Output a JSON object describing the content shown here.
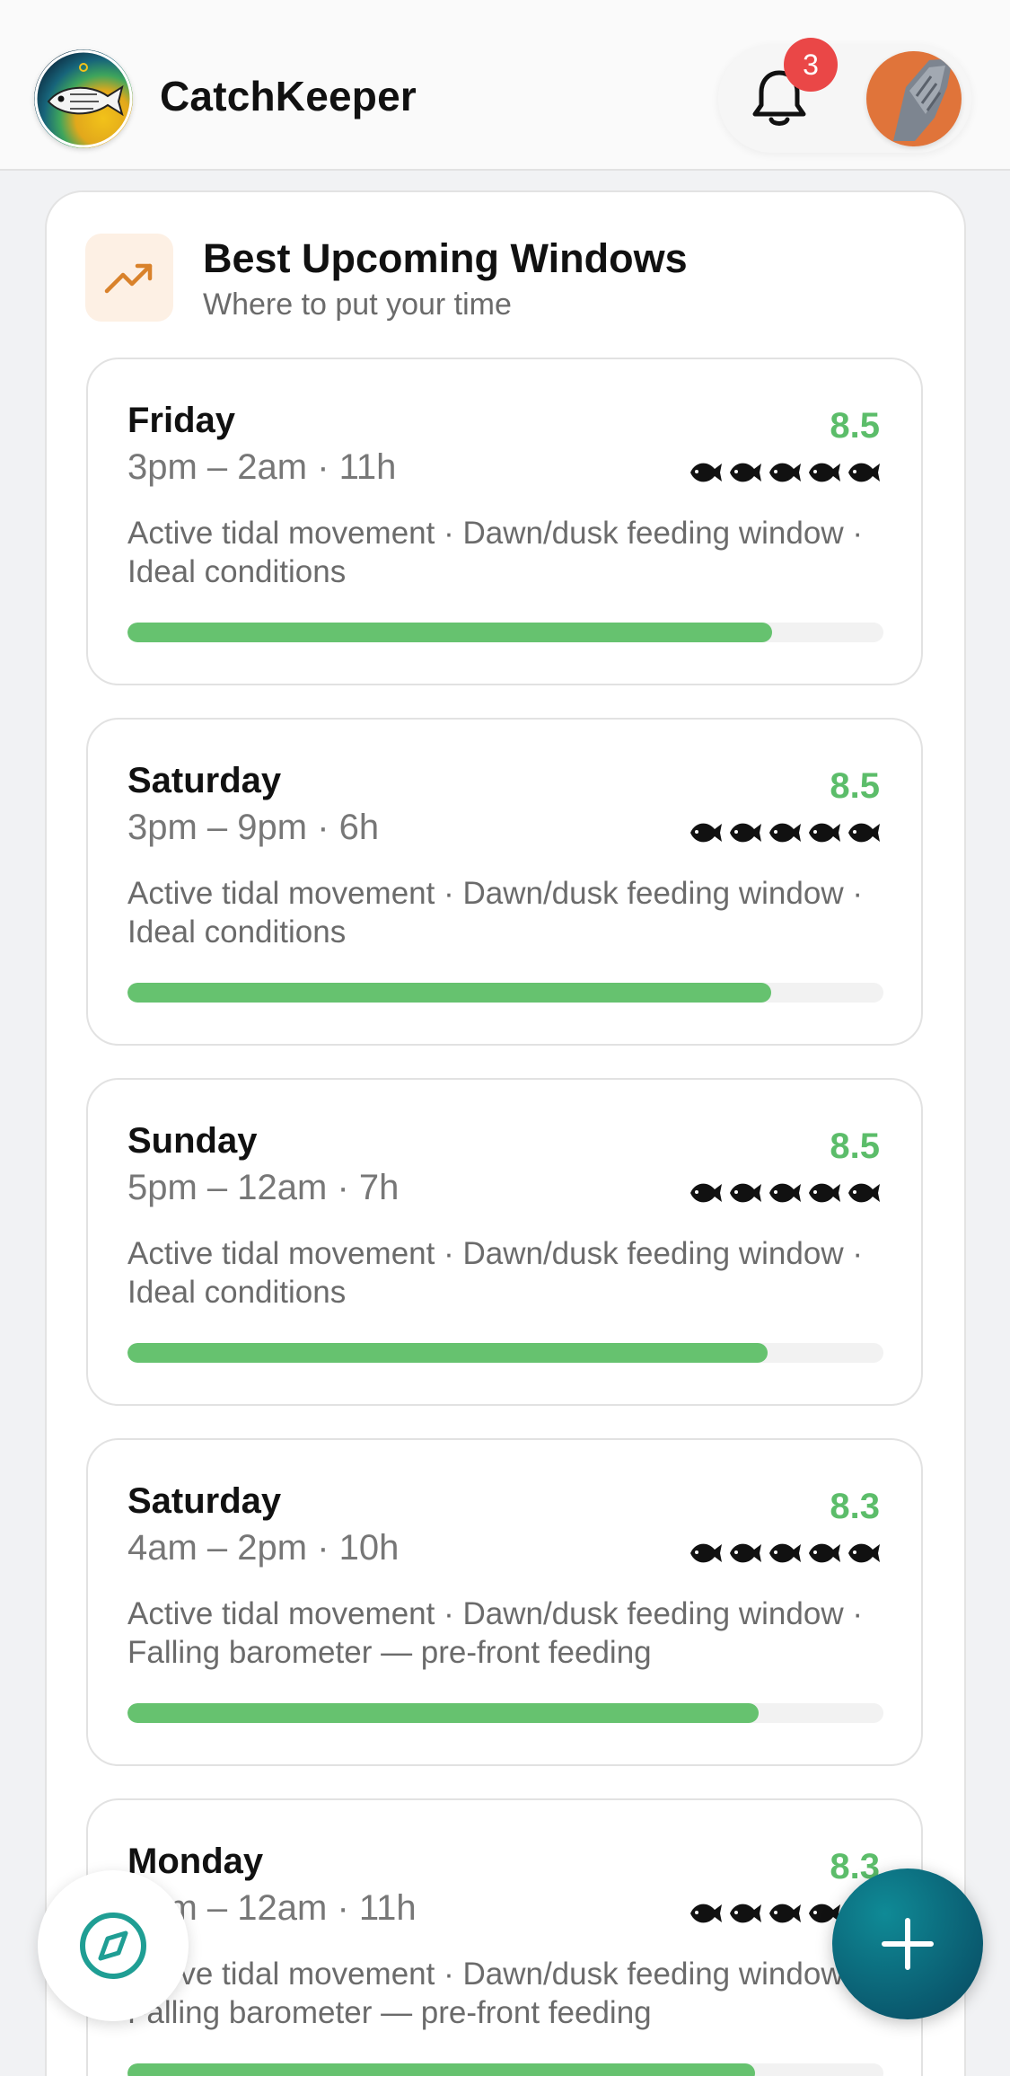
{
  "app": {
    "title": "CatchKeeper",
    "notification_count": "3"
  },
  "section": {
    "title": "Best Upcoming Windows",
    "subtitle": "Where to put your time",
    "icon": "trending-up-icon"
  },
  "colors": {
    "score_green": "#5cbd6a",
    "bar_fill": "#66c26f",
    "accent_orange": "#d9822b",
    "fab_teal": "#0a5a6f",
    "badge_red": "#ea4747"
  },
  "windows": [
    {
      "day": "Friday",
      "time": "3pm – 2am · 11h",
      "score": "8.5",
      "fish_rating": 5,
      "reasons": "Active tidal movement · Dawn/dusk feeding window · Ideal conditions",
      "progress": 0.853
    },
    {
      "day": "Saturday",
      "time": "3pm – 9pm · 6h",
      "score": "8.5",
      "fish_rating": 5,
      "reasons": "Active tidal movement · Dawn/dusk feeding window · Ideal conditions",
      "progress": 0.851
    },
    {
      "day": "Sunday",
      "time": "5pm – 12am · 7h",
      "score": "8.5",
      "fish_rating": 5,
      "reasons": "Active tidal movement · Dawn/dusk feeding window · Ideal conditions",
      "progress": 0.847
    },
    {
      "day": "Saturday",
      "time": "4am – 2pm · 10h",
      "score": "8.3",
      "fish_rating": 5,
      "reasons": "Active tidal movement · Dawn/dusk feeding window · Falling barometer — pre-front feeding",
      "progress": 0.835
    },
    {
      "day": "Monday",
      "time": "1pm – 12am · 11h",
      "score": "8.3",
      "fish_rating": 5,
      "reasons": "Active tidal movement · Dawn/dusk feeding window · Falling barometer — pre-front feeding",
      "progress": 0.83
    }
  ],
  "fab": {
    "left_icon": "compass-icon",
    "right_icon": "plus-icon"
  }
}
